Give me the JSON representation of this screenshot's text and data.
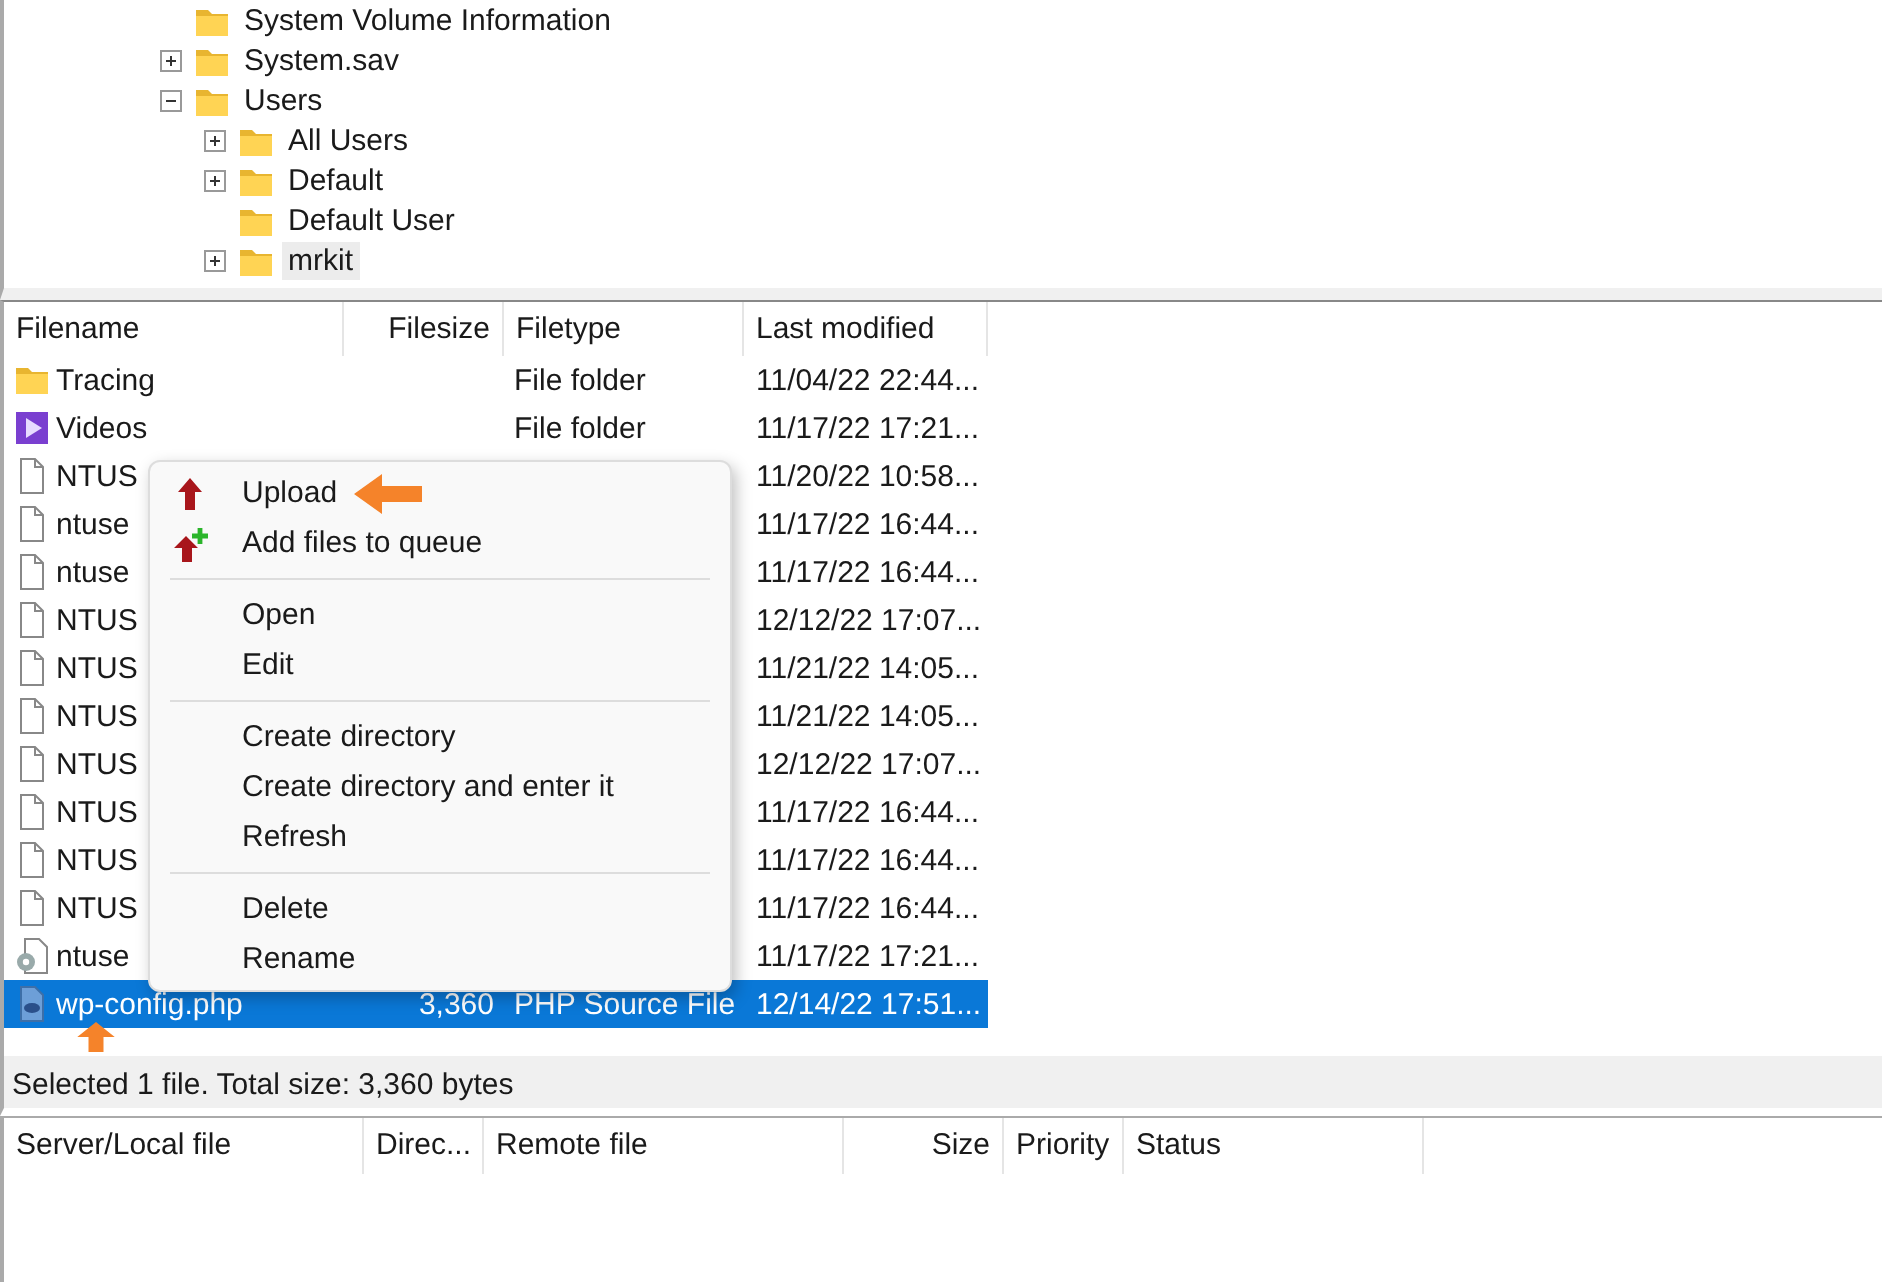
{
  "tree": [
    {
      "label": "System Volume Information"
    },
    {
      "label": "System.sav",
      "expanded": false,
      "selected": false
    },
    {
      "label": "Users",
      "expanded": true,
      "selected": false,
      "children": [
        {
          "label": "All Users",
          "expanded": false,
          "selected": false
        },
        {
          "label": "Default",
          "expanded": false,
          "selected": false
        },
        {
          "label": "Default User",
          "selected": false
        },
        {
          "label": "mrkit",
          "expanded": false,
          "selected": true
        }
      ]
    }
  ],
  "file_list": {
    "columns": [
      "Filename",
      "Filesize",
      "Filetype",
      "Last modified"
    ],
    "rows": [
      {
        "kind": "folder",
        "name": "Tracing",
        "size": "",
        "type": "File folder",
        "modified": "11/04/22 22:44...",
        "selected": false
      },
      {
        "kind": "video",
        "name": "Videos",
        "size": "",
        "type": "File folder",
        "modified": "11/17/22 17:21...",
        "selected": false
      },
      {
        "kind": "file",
        "name": "NTUS",
        "size": "",
        "type": "",
        "modified": "11/20/22 10:58...",
        "selected": false
      },
      {
        "kind": "file",
        "name": "ntuse",
        "size": "",
        "type": "",
        "modified": "11/17/22 16:44...",
        "selected": false
      },
      {
        "kind": "file",
        "name": "ntuse",
        "size": "",
        "type": "",
        "modified": "11/17/22 16:44...",
        "selected": false
      },
      {
        "kind": "file",
        "name": "NTUS",
        "size": "",
        "type": "",
        "modified": "12/12/22 17:07...",
        "selected": false
      },
      {
        "kind": "file",
        "name": "NTUS",
        "size": "",
        "type": "",
        "modified": "11/21/22 14:05...",
        "selected": false
      },
      {
        "kind": "file",
        "name": "NTUS",
        "size": "",
        "type": "",
        "modified": "11/21/22 14:05...",
        "selected": false
      },
      {
        "kind": "file",
        "name": "NTUS",
        "size": "",
        "type": "",
        "modified": "12/12/22 17:07...",
        "selected": false
      },
      {
        "kind": "file",
        "name": "NTUS",
        "size": "",
        "type": "",
        "modified": "11/17/22 16:44...",
        "selected": false
      },
      {
        "kind": "file",
        "name": "NTUS",
        "size": "",
        "type": "",
        "modified": "11/17/22 16:44...",
        "selected": false
      },
      {
        "kind": "file",
        "name": "NTUS",
        "size": "",
        "type": "",
        "modified": "11/17/22 16:44...",
        "selected": false
      },
      {
        "kind": "settings",
        "name": "ntuse",
        "size": "",
        "type": "",
        "modified": "11/17/22 17:21...",
        "selected": false
      },
      {
        "kind": "php",
        "name": "wp-config.php",
        "size": "3,360",
        "type": "PHP Source File",
        "modified": "12/14/22 17:51...",
        "selected": true
      }
    ]
  },
  "context_menu": [
    [
      {
        "label": "Upload",
        "kind": "upload"
      },
      {
        "label": "Add files to queue",
        "kind": "add"
      }
    ],
    [
      {
        "label": "Open",
        "kind": "plain"
      },
      {
        "label": "Edit",
        "kind": "plain"
      }
    ],
    [
      {
        "label": "Create directory",
        "kind": "plain"
      },
      {
        "label": "Create directory and enter it",
        "kind": "plain"
      },
      {
        "label": "Refresh",
        "kind": "plain"
      }
    ],
    [
      {
        "label": "Delete",
        "kind": "plain"
      },
      {
        "label": "Rename",
        "kind": "plain"
      }
    ]
  ],
  "status_bar": "Selected 1 file. Total size: 3,360 bytes",
  "queue": {
    "columns": [
      "Server/Local file",
      "Direc...",
      "Remote file",
      "Size",
      "Priority",
      "Status"
    ]
  }
}
